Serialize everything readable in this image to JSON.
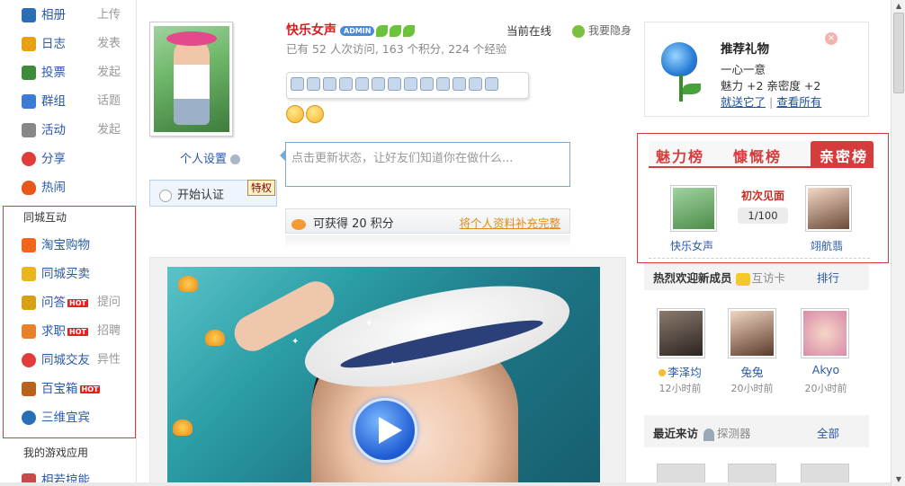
{
  "sidebar": {
    "items": [
      {
        "label": "相册",
        "action": "上传",
        "icon": "photo-icon",
        "color": "#2a6fb6"
      },
      {
        "label": "日志",
        "action": "发表",
        "icon": "journal-icon",
        "color": "#e8a014"
      },
      {
        "label": "投票",
        "action": "发起",
        "icon": "vote-icon",
        "color": "#3c8c3c"
      },
      {
        "label": "群组",
        "action": "话题",
        "icon": "group-icon",
        "color": "#3a7bd5"
      },
      {
        "label": "活动",
        "action": "发起",
        "icon": "calendar-icon",
        "color": "#777"
      },
      {
        "label": "分享",
        "action": "",
        "icon": "heart-icon",
        "color": "#e23b3b"
      },
      {
        "label": "热闹",
        "action": "",
        "icon": "fire-icon",
        "color": "#e8561a"
      }
    ],
    "local_title": "同城互动",
    "local_items": [
      {
        "label": "淘宝购物",
        "action": "",
        "hot": false,
        "icon": "taobao-icon",
        "color": "#f2661c"
      },
      {
        "label": "同城买卖",
        "action": "",
        "hot": false,
        "icon": "trade-icon",
        "color": "#e9b520"
      },
      {
        "label": "问答",
        "action": "提问",
        "hot": true,
        "icon": "question-icon",
        "color": "#d6a017"
      },
      {
        "label": "求职",
        "action": "招聘",
        "hot": true,
        "icon": "job-icon",
        "color": "#e9812a"
      },
      {
        "label": "同城交友",
        "action": "异性",
        "hot": false,
        "icon": "friends-icon",
        "color": "#e23b3b"
      },
      {
        "label": "百宝箱",
        "action": "",
        "hot": true,
        "icon": "treasure-icon",
        "color": "#b8621e"
      },
      {
        "label": "三维宜宾",
        "action": "",
        "hot": false,
        "icon": "globe-icon",
        "color": "#2a6fb6"
      }
    ],
    "hot_label": "HOT",
    "games_title": "我的游戏应用",
    "last_item_partial": "相若掠能"
  },
  "profile": {
    "name": "快乐女声",
    "admin_badge": "ADMIN",
    "online_label": "当前在线",
    "hide_label": "我要隐身",
    "stats": "已有 52 人次访问, 163 个积分, 224 个经验",
    "settings_label": "个人设置",
    "status_placeholder": "点击更新状态，让好友们知道你在做什么...",
    "cert_label": "开始认证",
    "cert_badge": "特权",
    "points_text": "可获得 20 积分",
    "points_link": "将个人资料补充完整"
  },
  "gift": {
    "title": "推荐礼物",
    "line1": "一心一意",
    "line2": "魅力 +2  亲密度 +2",
    "send_link": "就送它了",
    "sep": "|",
    "all_link": "查看所有"
  },
  "rank": {
    "tabs": [
      "魅力榜",
      "慷慨榜",
      "亲密榜"
    ],
    "first_meet": "初次见面",
    "count": "1/100",
    "left_name": "快乐女声",
    "right_name": "翊航翡"
  },
  "new_members": {
    "title": "热烈欢迎新成员",
    "sub": "互访卡",
    "rank_btn": "排行",
    "members": [
      {
        "name": "李泽均",
        "time": "12小时前"
      },
      {
        "name": "兔兔",
        "time": "20小时前"
      },
      {
        "name": "Akyo",
        "time": "20小时前"
      }
    ]
  },
  "visitors": {
    "title": "最近来访",
    "sub": "探测器",
    "all": "全部"
  }
}
